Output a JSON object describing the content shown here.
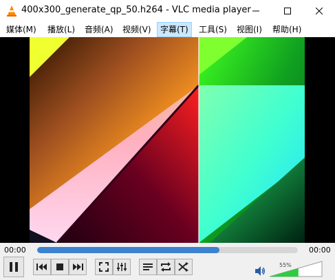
{
  "window": {
    "title": "400x300_generate_qp_50.h264 - VLC media player"
  },
  "menu": [
    {
      "label": "媒体(M)"
    },
    {
      "label": "播放(L)"
    },
    {
      "label": "音频(A)"
    },
    {
      "label": "视频(V)"
    },
    {
      "label": "字幕(T)",
      "active": true
    },
    {
      "label": "工具(S)"
    },
    {
      "label": "视图(I)"
    },
    {
      "label": "帮助(H)"
    }
  ],
  "playback": {
    "elapsed": "00:00",
    "total": "00:00",
    "progress": 0.7
  },
  "volume": {
    "label": "55%",
    "level": 0.55
  },
  "icons": {
    "app": "vlc-cone-icon",
    "play_pause": "pause-icon",
    "prev": "previous-icon",
    "stop": "stop-icon",
    "next": "next-icon",
    "fullscreen": "fullscreen-icon",
    "extended": "extended-settings-icon",
    "playlist": "playlist-icon",
    "loop": "loop-icon",
    "random": "shuffle-icon",
    "volume": "speaker-icon"
  },
  "colors": {
    "seek_fill": "#3c82d0",
    "volume_fill": "#2ecc40",
    "accent_orange": "#ff8800"
  }
}
